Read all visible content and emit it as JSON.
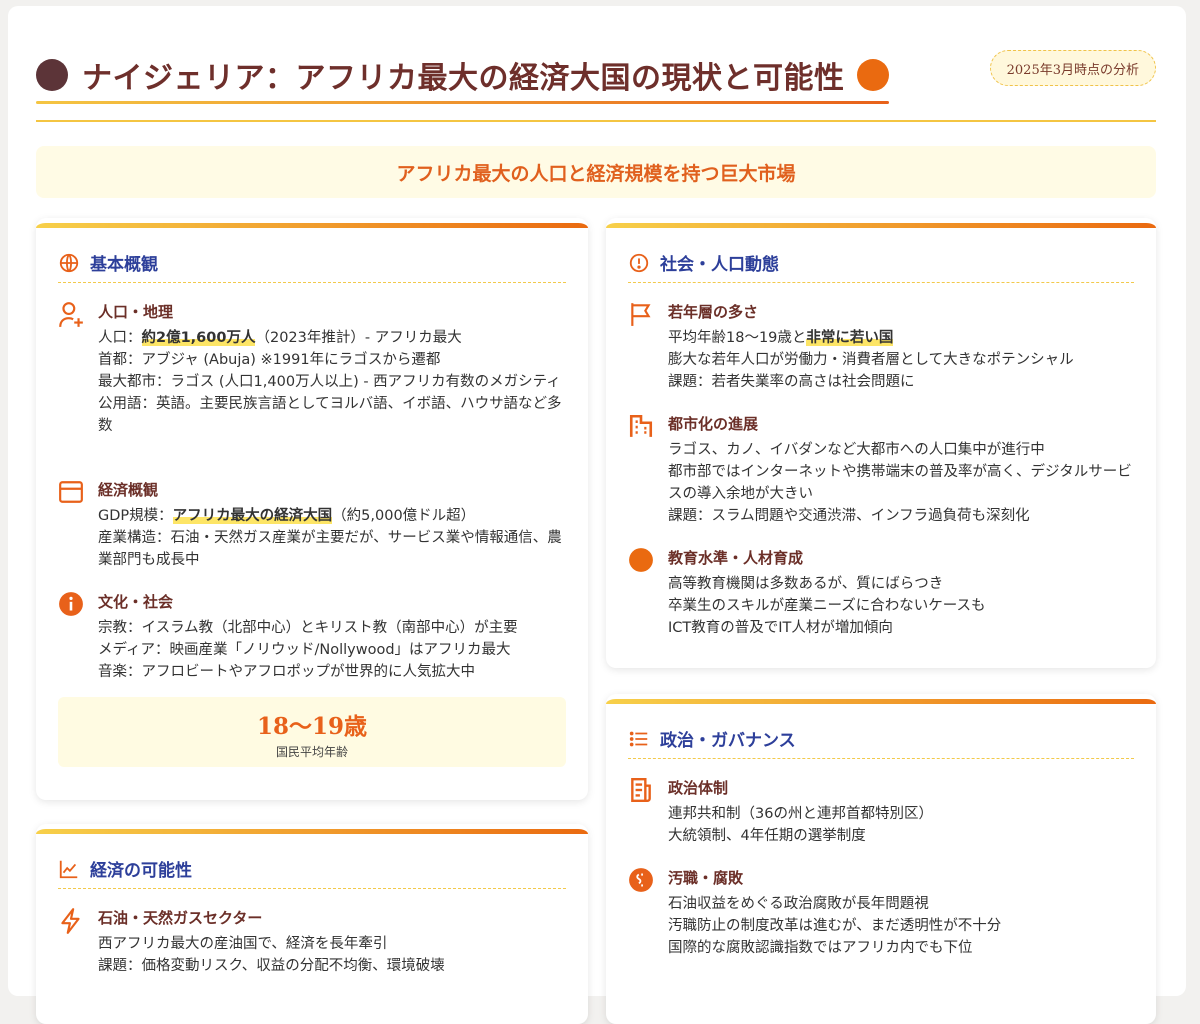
{
  "header": {
    "title": "ナイジェリア：アフリカ最大の経済大国の現状と可能性",
    "date_badge": "2025年3月時点の分析"
  },
  "subtitle": "アフリカ最大の人口と経済規模を持つ巨大市場",
  "colors": {
    "accent": "#e8611a",
    "brand_dark": "#6e2f2b",
    "heading_blue": "#2d3f9a",
    "highlight": "#fde566"
  },
  "basic": {
    "title": "基本概観",
    "icon": "globe-icon",
    "sections": [
      {
        "heading": "人口・地理",
        "icon": "user-plus-icon",
        "lines": [
          {
            "pre": "人口：",
            "hl": "約2億1,600万人",
            "post": "（2023年推計）- アフリカ最大"
          },
          {
            "pre": "首都：アブジャ (Abuja) ※1991年にラゴスから遷都"
          },
          {
            "pre": "最大都市：ラゴス (人口1,400万人以上) - 西アフリカ有数のメガシティ"
          },
          {
            "pre": "公用語：英語。主要民族言語としてヨルバ語、イボ語、ハウサ語など多数"
          }
        ]
      },
      {
        "heading": "経済概観",
        "icon": "window-icon",
        "lines": [
          {
            "pre": "GDP規模：",
            "hl": "アフリカ最大の経済大国",
            "post": "（約5,000億ドル超）"
          },
          {
            "pre": "産業構造：石油・天然ガス産業が主要だが、サービス業や情報通信、農業部門も成長中"
          }
        ]
      },
      {
        "heading": "文化・社会",
        "icon": "info-icon",
        "lines": [
          {
            "pre": "宗教：イスラム教（北部中心）とキリスト教（南部中心）が主要"
          },
          {
            "pre": "メディア：映画産業「ノリウッド/Nollywood」はアフリカ最大"
          },
          {
            "pre": "音楽：アフロビートやアフロポップが世界的に人気拡大中"
          }
        ]
      }
    ],
    "stat": {
      "value": "18〜19歳",
      "label": "国民平均年齢"
    }
  },
  "social": {
    "title": "社会・人口動態",
    "icon": "alert-circle-icon",
    "sections": [
      {
        "heading": "若年層の多さ",
        "icon": "flag-icon",
        "lines": [
          {
            "pre": "平均年齢18〜19歳と",
            "hl": "非常に若い国"
          },
          {
            "pre": "膨大な若年人口が労働力・消費者層として大きなポテンシャル"
          },
          {
            "pre": "課題：若者失業率の高さは社会問題に"
          }
        ]
      },
      {
        "heading": "都市化の進展",
        "icon": "building-icon",
        "lines": [
          {
            "pre": "ラゴス、カノ、イバダンなど大都市への人口集中が進行中"
          },
          {
            "pre": "都市部ではインターネットや携帯端末の普及率が高く、デジタルサービスの導入余地が大きい"
          },
          {
            "pre": "課題：スラム問題や交通渋滞、インフラ過負荷も深刻化"
          }
        ]
      },
      {
        "heading": "教育水準・人材育成",
        "icon": "circle-icon",
        "lines": [
          {
            "pre": "高等教育機関は多数あるが、質にばらつき"
          },
          {
            "pre": "卒業生のスキルが産業ニーズに合わないケースも"
          },
          {
            "pre": "ICT教育の普及でIT人材が増加傾向"
          }
        ]
      }
    ]
  },
  "economy": {
    "title": "経済の可能性",
    "icon": "chart-line-icon",
    "sections": [
      {
        "heading": "石油・天然ガスセクター",
        "icon": "lightning-icon",
        "lines": [
          {
            "pre": "西アフリカ最大の産油国で、経済を長年牽引"
          },
          {
            "pre": "課題：価格変動リスク、収益の分配不均衡、環境破壊"
          }
        ]
      }
    ]
  },
  "politics": {
    "title": "政治・ガバナンス",
    "icon": "list-icon",
    "sections": [
      {
        "heading": "政治体制",
        "icon": "document-icon",
        "lines": [
          {
            "pre": "連邦共和制（36の州と連邦首都特別区）"
          },
          {
            "pre": "大統領制、4年任期の選挙制度"
          }
        ]
      },
      {
        "heading": "汚職・腐敗",
        "icon": "coin-icon",
        "lines": [
          {
            "pre": "石油収益をめぐる政治腐敗が長年問題視"
          },
          {
            "pre": "汚職防止の制度改革は進むが、まだ透明性が不十分"
          },
          {
            "pre": "国際的な腐敗認識指数ではアフリカ内でも下位"
          }
        ]
      }
    ]
  }
}
